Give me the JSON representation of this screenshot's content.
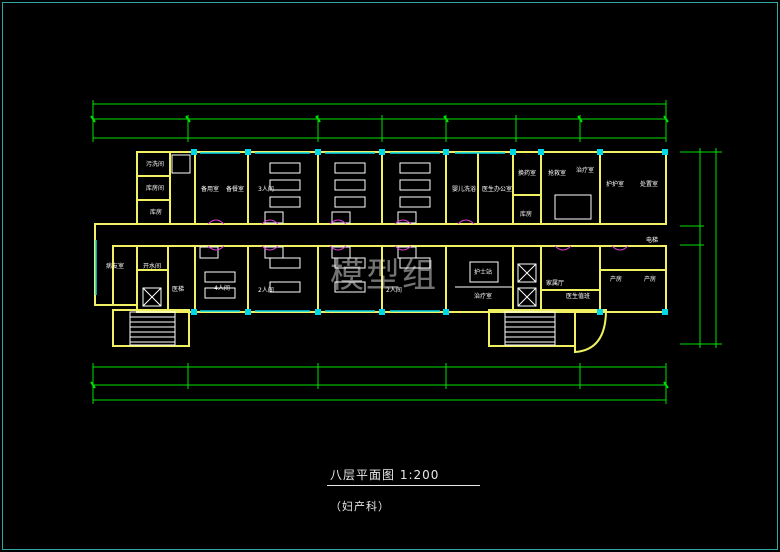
{
  "drawing": {
    "title": "八层平面图 1:200",
    "subtitle": "（妇产科）",
    "watermark": "模型组"
  },
  "rooms": {
    "r1": "污洗间",
    "r2": "库房间",
    "r3": "库房",
    "r4": "备用室",
    "r5": "备餐室",
    "r6": "3人间",
    "r7": "婴儿洗浴",
    "r8": "医生办公室",
    "r9": "换药室",
    "r10": "抢救室",
    "r11": "治疗室",
    "r12": "库房",
    "r13": "护护室",
    "r14": "处置室",
    "r15": "病友室",
    "r16": "开水间",
    "r17": "医梯",
    "r18": "4人间",
    "r19": "2人间",
    "r20": "2人间",
    "r21": "护士站",
    "r22": "治疗室",
    "r23": "家属厅",
    "r24": "医生值班",
    "r25": "产房",
    "r26": "产房",
    "r27": "电梯"
  },
  "colors": {
    "wall": "#f0f060",
    "grid": "#00e000",
    "cyan": "#00d8e8",
    "white": "#ffffff",
    "magenta": "#e040e0"
  }
}
